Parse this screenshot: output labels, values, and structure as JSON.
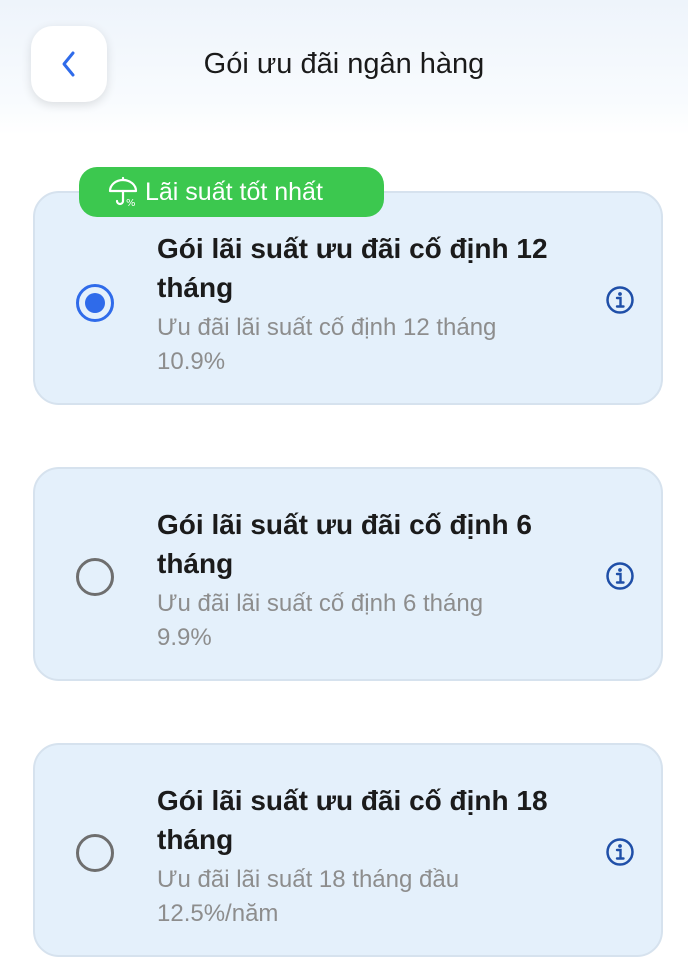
{
  "header": {
    "title": "Gói ưu đãi ngân hàng",
    "back_icon": "chevron-left-icon"
  },
  "badge": {
    "label": "Lãi suất tốt nhất",
    "icon": "umbrella-percent-icon",
    "color": "#3cc84f"
  },
  "options": [
    {
      "title_line1": "Gói lãi suất ưu đãi cố định 12",
      "title_line2": "tháng",
      "desc_line1": "Ưu đãi lãi suất cố định 12 tháng",
      "desc_line2": "10.9%",
      "selected": true
    },
    {
      "title_line1": "Gói lãi suất ưu đãi cố định 6",
      "title_line2": "tháng",
      "desc_line1": "Ưu đãi lãi suất cố định 6 tháng",
      "desc_line2": "9.9%",
      "selected": false
    },
    {
      "title_line1": "Gói lãi suất ưu đãi cố định 18",
      "title_line2": "tháng",
      "desc_line1": "Ưu đãi lãi suất 18 tháng đầu",
      "desc_line2": "12.5%/năm",
      "selected": false
    }
  ],
  "colors": {
    "accent": "#2f6bea",
    "card_bg": "#e4f0fb",
    "info": "#1f4fa8"
  }
}
